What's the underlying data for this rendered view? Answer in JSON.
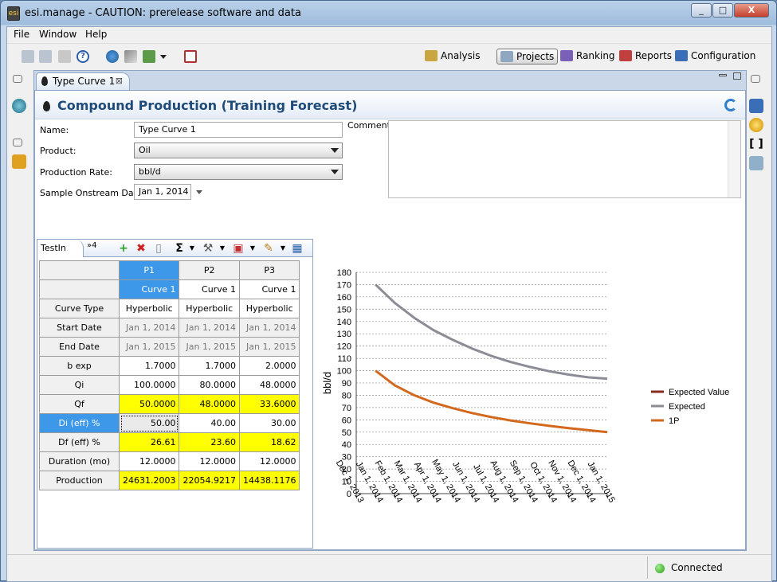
{
  "window": {
    "title": "esi.manage - CAUTION: prerelease software and data",
    "minimize": "_",
    "maximize": "□",
    "close": "X"
  },
  "menu": [
    "File",
    "Window",
    "Help"
  ],
  "perspectives": [
    {
      "label": "Analysis",
      "icon": "analysis-scale-icon"
    },
    {
      "label": "Projects",
      "icon": "projects-icon",
      "selected": true
    },
    {
      "label": "Ranking",
      "icon": "ranking-icon"
    },
    {
      "label": "Reports",
      "icon": "reports-icon"
    },
    {
      "label": "Configuration",
      "icon": "configuration-icon"
    }
  ],
  "editor": {
    "tab_label": "Type Curve 1",
    "tab_close": "⊠",
    "header_title": "Compound Production (Training Forecast)"
  },
  "form": {
    "name_label": "Name:",
    "name_value": "Type Curve 1",
    "product_label": "Product:",
    "product_value": "Oil",
    "rate_label": "Production Rate:",
    "rate_value": "bbl/d",
    "onstream_label": "Sample Onstream Date:",
    "onstream_value": "Jan 1, 2014",
    "comment_label": "Comment:",
    "comment_value": ""
  },
  "table_panel": {
    "tab_label": "TestIn",
    "more_tabs": "»4",
    "columns": [
      {
        "id": "P1",
        "curve": "Curve 1"
      },
      {
        "id": "P2",
        "curve": "Curve 1"
      },
      {
        "id": "P3",
        "curve": "Curve 1"
      }
    ],
    "rows": [
      {
        "label": "Curve Type",
        "values": [
          "Hyperbolic",
          "Hyperbolic",
          "Hyperbolic"
        ],
        "style": "center"
      },
      {
        "label": "Start Date",
        "values": [
          "Jan 1, 2014",
          "Jan 1, 2014",
          "Jan 1, 2014"
        ],
        "style": "gray"
      },
      {
        "label": "End Date",
        "values": [
          "Jan 1, 2015",
          "Jan 1, 2015",
          "Jan 1, 2015"
        ],
        "style": "gray"
      },
      {
        "label": "b exp",
        "values": [
          "1.7000",
          "1.7000",
          "2.0000"
        ],
        "style": "plain"
      },
      {
        "label": "Qi",
        "values": [
          "100.0000",
          "80.0000",
          "48.0000"
        ],
        "style": "plain"
      },
      {
        "label": "Qf",
        "values": [
          "50.0000",
          "48.0000",
          "33.6000"
        ],
        "style": "yellow"
      },
      {
        "label": "Di (eff) %",
        "values": [
          "50.00",
          "40.00",
          "30.00"
        ],
        "style": "selected"
      },
      {
        "label": "Df (eff) %",
        "values": [
          "26.61",
          "23.60",
          "18.62"
        ],
        "style": "yellow"
      },
      {
        "label": "Duration (mo)",
        "values": [
          "12.0000",
          "12.0000",
          "12.0000"
        ],
        "style": "plain"
      },
      {
        "label": "Production",
        "values": [
          "24631.2003",
          "22054.9217",
          "14438.1176"
        ],
        "style": "yellow"
      }
    ]
  },
  "chart_data": {
    "type": "line",
    "ylabel": "bbl/d",
    "xlabel": "",
    "ylim": [
      0,
      180
    ],
    "yticks": [
      0,
      10,
      20,
      30,
      40,
      50,
      60,
      70,
      80,
      90,
      100,
      110,
      120,
      130,
      140,
      150,
      160,
      170,
      180
    ],
    "categories": [
      "Dec 1, 2013",
      "Jan 1, 2014",
      "Feb 1, 2014",
      "Mar 1, 2014",
      "Apr 1, 2014",
      "May 1, 2014",
      "Jun 1, 2014",
      "Jul 1, 2014",
      "Aug 1, 2014",
      "Sep 1, 2014",
      "Oct 1, 2014",
      "Nov 1, 2014",
      "Dec 1, 2014",
      "Jan 1, 2015"
    ],
    "grid": true,
    "legend_position": "right",
    "series": [
      {
        "name": "Expected Value",
        "color": "#8b2a1e",
        "values": [
          null,
          null,
          null,
          null,
          null,
          null,
          null,
          null,
          null,
          null,
          null,
          null,
          null,
          null
        ]
      },
      {
        "name": "Expected",
        "color": "#8c8c96",
        "values": [
          null,
          170,
          155,
          143,
          133,
          125,
          118,
          112,
          107,
          103,
          99.5,
          96.8,
          94.6,
          93.5
        ]
      },
      {
        "name": "1P",
        "color": "#d2691e",
        "values": [
          null,
          100,
          88,
          80,
          74,
          69.5,
          65.5,
          62.2,
          59.5,
          57.2,
          55.1,
          53.3,
          51.6,
          50
        ]
      }
    ]
  },
  "status": {
    "connection": "Connected"
  }
}
